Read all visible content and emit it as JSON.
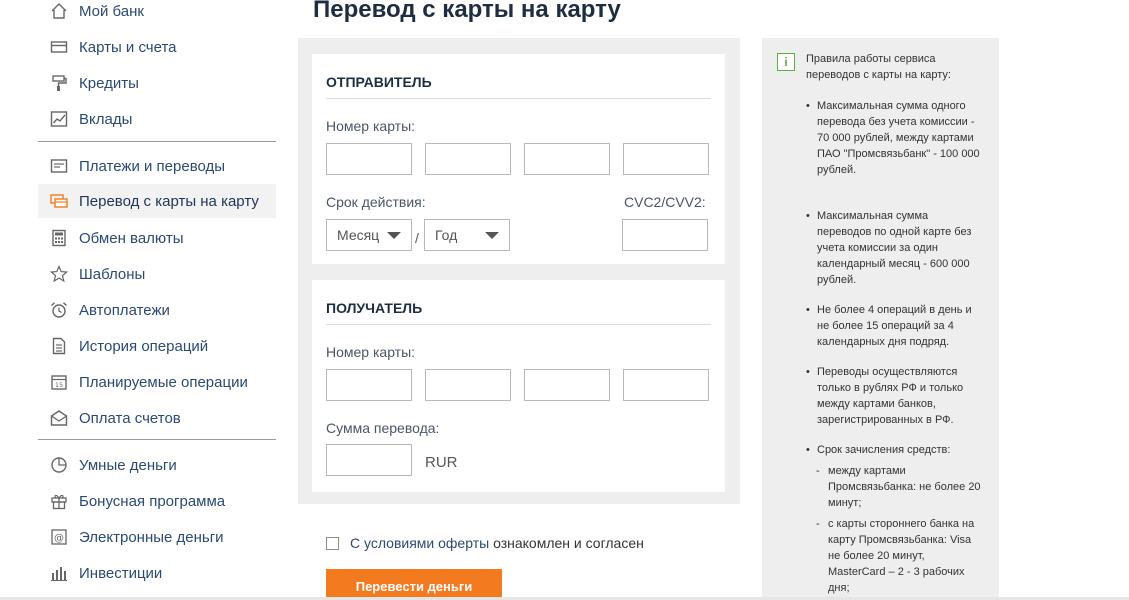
{
  "sidebar": {
    "items": [
      {
        "label": "Мой банк",
        "icon": "home-icon"
      },
      {
        "label": "Карты и счета",
        "icon": "card-icon"
      },
      {
        "label": "Кредиты",
        "icon": "roller-icon"
      },
      {
        "label": "Вклады",
        "icon": "chart-icon"
      },
      {
        "label": "Платежи и переводы",
        "icon": "payment-icon"
      },
      {
        "label": "Перевод с карты на карту",
        "icon": "card-transfer-icon"
      },
      {
        "label": "Обмен валюты",
        "icon": "calculator-icon"
      },
      {
        "label": "Шаблоны",
        "icon": "star-icon"
      },
      {
        "label": "Автоплатежи",
        "icon": "alarm-clock-icon"
      },
      {
        "label": "История операций",
        "icon": "document-icon"
      },
      {
        "label": "Планируемые операции",
        "icon": "calendar-icon"
      },
      {
        "label": "Оплата счетов",
        "icon": "envelope-icon"
      },
      {
        "label": "Умные деньги",
        "icon": "pie-chart-icon"
      },
      {
        "label": "Бонусная программа",
        "icon": "gift-icon"
      },
      {
        "label": "Электронные деньги",
        "icon": "at-card-icon"
      },
      {
        "label": "Инвестиции",
        "icon": "bars-icon"
      }
    ],
    "active_index": 5
  },
  "page_title": "Перевод с карты на карту",
  "sender": {
    "heading": "ОТПРАВИТЕЛЬ",
    "card_number_label": "Номер карты:",
    "expiry_label": "Срок действия:",
    "month_value": "Месяц",
    "year_value": "Год",
    "separator": "/",
    "cvc_label": "CVC2/CVV2:"
  },
  "receiver": {
    "heading": "ПОЛУЧАТЕЛЬ",
    "card_number_label": "Номер карты:",
    "amount_label": "Сумма перевода:",
    "currency": "RUR"
  },
  "agreement": {
    "link_text": "С условиями оферты",
    "rest_text": " ознакомлен и согласен"
  },
  "submit_label": "Перевести деньги",
  "info": {
    "icon_glyph": "i",
    "intro": "Правила работы сервиса переводов с карты на карту:",
    "bullet": "•",
    "rules": [
      "Максимальная сумма одного перевода без учета комиссии - 70 000 рублей, между картами ПАО \"Промсвязьбанк\" - 100 000 рублей.",
      "Максимальная сумма переводов по одной карте без учета комиссии за один календарный месяц - 600 000 рублей.",
      "Не более 4 операций в день и не более 15 операций за 4 календарных дня подряд.",
      "Переводы осуществляются только в рублях РФ и только между картами банков, зарегистрированных в РФ.",
      "Срок зачисления средств:"
    ],
    "dash": "-",
    "subrules": [
      "между картами Промсвязьбанка: не более 20 минут;",
      "с карты стороннего банка на карту Промсвязьбанка: Visa не более 20 минут, MasterCard – 2 - 3 рабочих дня;"
    ]
  },
  "colors": {
    "accent": "#f47a20",
    "nav_text": "#2b4a73",
    "panel_bg": "#eeeeee",
    "info_icon": "#5fae3c"
  }
}
